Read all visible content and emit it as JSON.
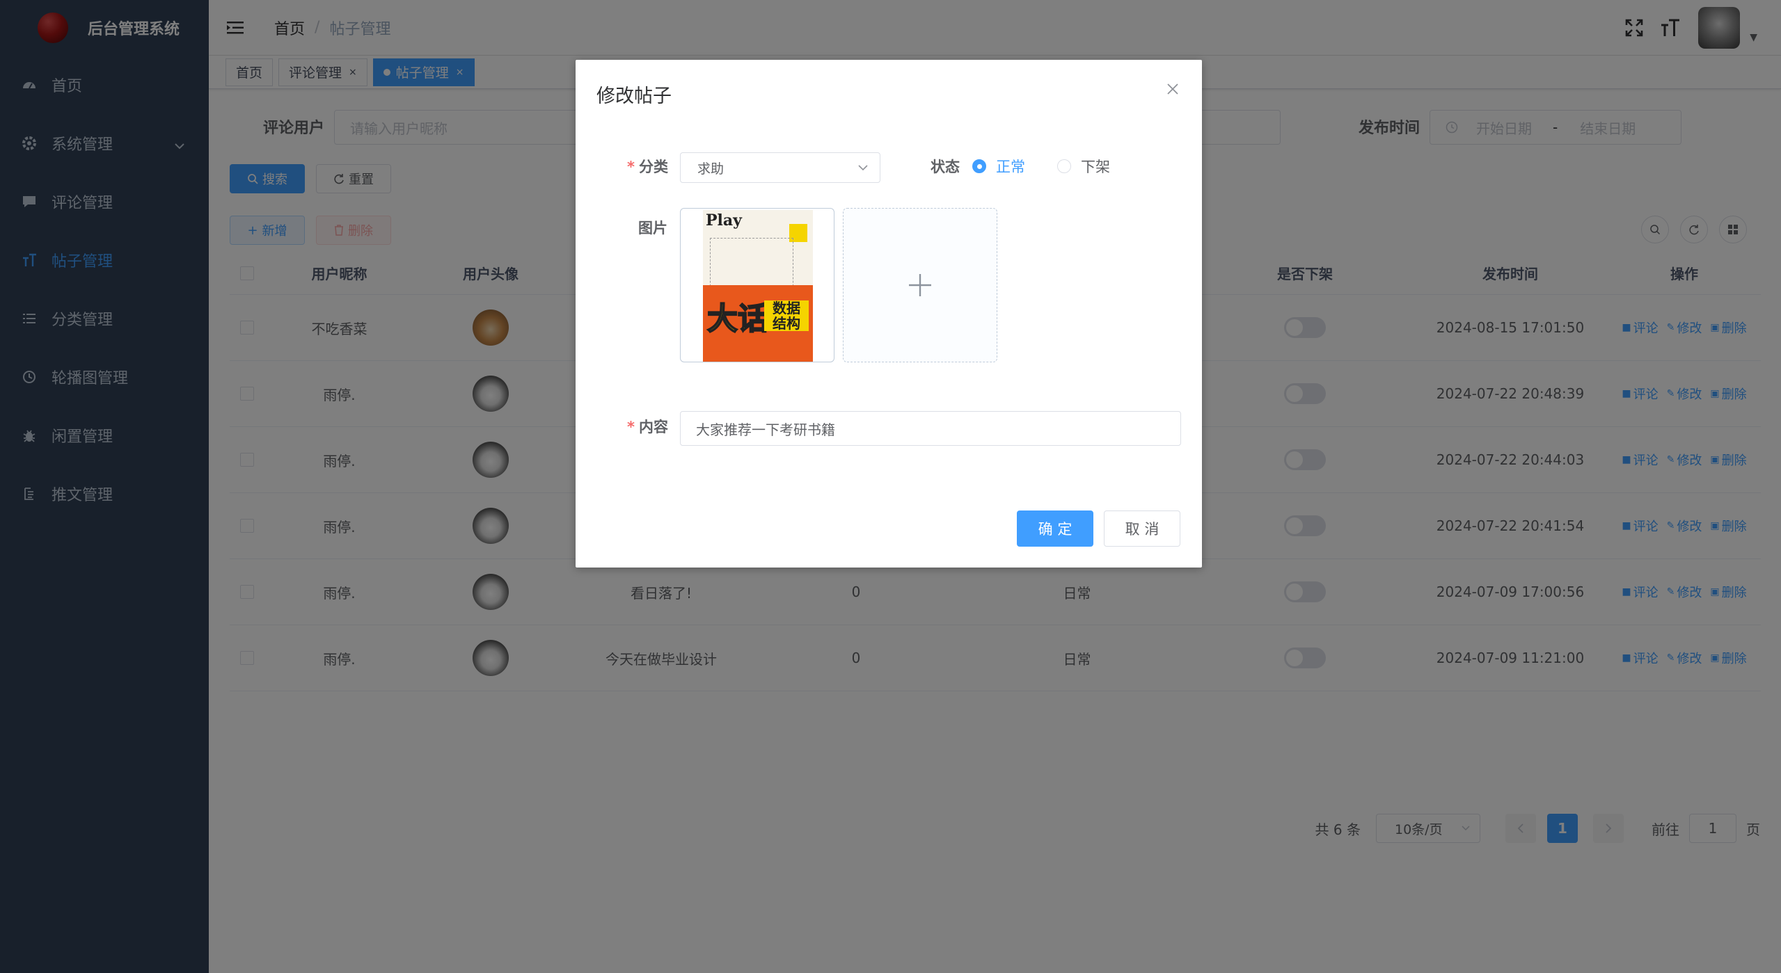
{
  "app": {
    "title": "后台管理系统"
  },
  "sidebar": {
    "items": [
      {
        "label": "首页",
        "icon": "dashboard-icon"
      },
      {
        "label": "系统管理",
        "icon": "gear-icon"
      },
      {
        "label": "评论管理",
        "icon": "message-icon"
      },
      {
        "label": "帖子管理",
        "icon": "text-size-icon",
        "active": true
      },
      {
        "label": "分类管理",
        "icon": "list-icon"
      },
      {
        "label": "轮播图管理",
        "icon": "clock-icon"
      },
      {
        "label": "闲置管理",
        "icon": "bug-icon"
      },
      {
        "label": "推文管理",
        "icon": "document-icon"
      }
    ]
  },
  "header": {
    "breadcrumb": {
      "home": "首页",
      "sep": "/",
      "current": "帖子管理"
    }
  },
  "tags": [
    {
      "label": "首页"
    },
    {
      "label": "评论管理",
      "close": "×"
    },
    {
      "label": "帖子管理",
      "close": "×",
      "active": true
    }
  ],
  "search": {
    "user_label": "评论用户",
    "user_placeholder": "请输入用户昵称",
    "time_label": "发布时间",
    "start_placeholder": "开始日期",
    "range_sep": "-",
    "end_placeholder": "结束日期",
    "search_button": "搜索",
    "reset_button": "重置"
  },
  "toolbar": {
    "add_button": "新增",
    "delete_button": "删除"
  },
  "table": {
    "columns": {
      "nickname": "用户昵称",
      "avatar": "用户头像",
      "off": "是否下架",
      "time": "发布时间",
      "op": "操作"
    },
    "rows": [
      {
        "nickname": "不吃香菜",
        "title": "",
        "count": "",
        "category": "",
        "time": "2024-08-15 17:01:50"
      },
      {
        "nickname": "雨停.",
        "title": "",
        "count": "",
        "category": "",
        "time": "2024-07-22 20:48:39"
      },
      {
        "nickname": "雨停.",
        "title": "",
        "count": "",
        "category": "",
        "time": "2024-07-22 20:44:03"
      },
      {
        "nickname": "雨停.",
        "title": "",
        "count": "",
        "category": "",
        "time": "2024-07-22 20:41:54"
      },
      {
        "nickname": "雨停.",
        "title": "看日落了!",
        "count": "0",
        "category": "日常",
        "time": "2024-07-09 17:00:56"
      },
      {
        "nickname": "雨停.",
        "title": "今天在做毕业设计",
        "count": "0",
        "category": "日常",
        "time": "2024-07-09 11:21:00"
      }
    ],
    "ops": {
      "comment": "评论",
      "edit": "修改",
      "delete": "删除"
    }
  },
  "pager": {
    "total": "共 6 条",
    "size": "10条/页",
    "current": "1",
    "goto": "前往",
    "goto_value": "1",
    "page_unit": "页"
  },
  "dialog": {
    "title": "修改帖子",
    "required_mark": "*",
    "category_label": "分类",
    "category_value": "求助",
    "status_label": "状态",
    "status_options": [
      "正常",
      "下架"
    ],
    "status_selected": "正常",
    "image_label": "图片",
    "content_label": "内容",
    "content_value": "大家推荐一下考研书籍",
    "ok_button": "确 定",
    "cancel_button": "取 消",
    "cover": {
      "play": "Play",
      "big": "大话",
      "sub1": "数据",
      "sub2": "结构"
    }
  },
  "colors": {
    "sidebar_bg": "#304156",
    "primary": "#409eff",
    "danger": "#f56c6c"
  }
}
